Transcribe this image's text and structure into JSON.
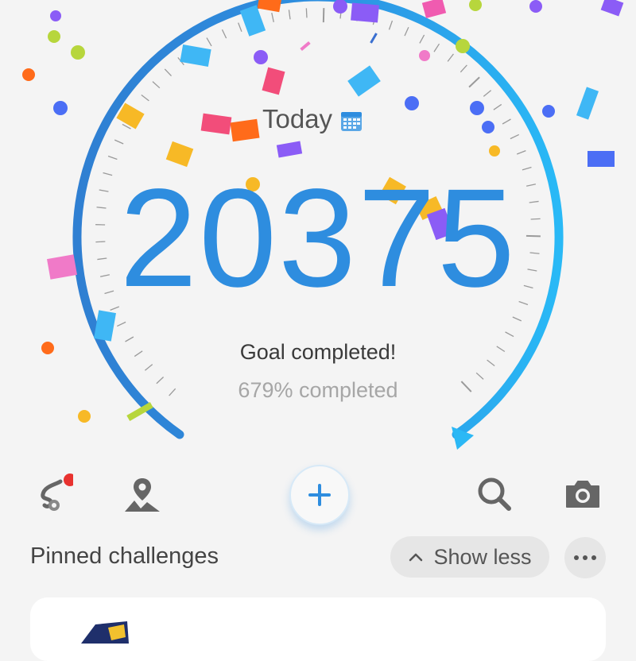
{
  "header": {
    "date_label": "Today"
  },
  "counter": {
    "steps": "20375",
    "status": "Goal completed!",
    "progress_text": "679% completed",
    "progress_fraction": 6.79
  },
  "toolbar": {
    "items": [
      "route-icon",
      "location-icon",
      "add-button",
      "search-icon",
      "camera-icon"
    ],
    "has_notification": true
  },
  "pinned": {
    "title": "Pinned challenges",
    "show_less_label": "Show less"
  },
  "colors": {
    "accent": "#2e8ddf",
    "accent_light": "#2bb8f5",
    "notification": "#e8322f",
    "background": "#f4f4f4"
  }
}
